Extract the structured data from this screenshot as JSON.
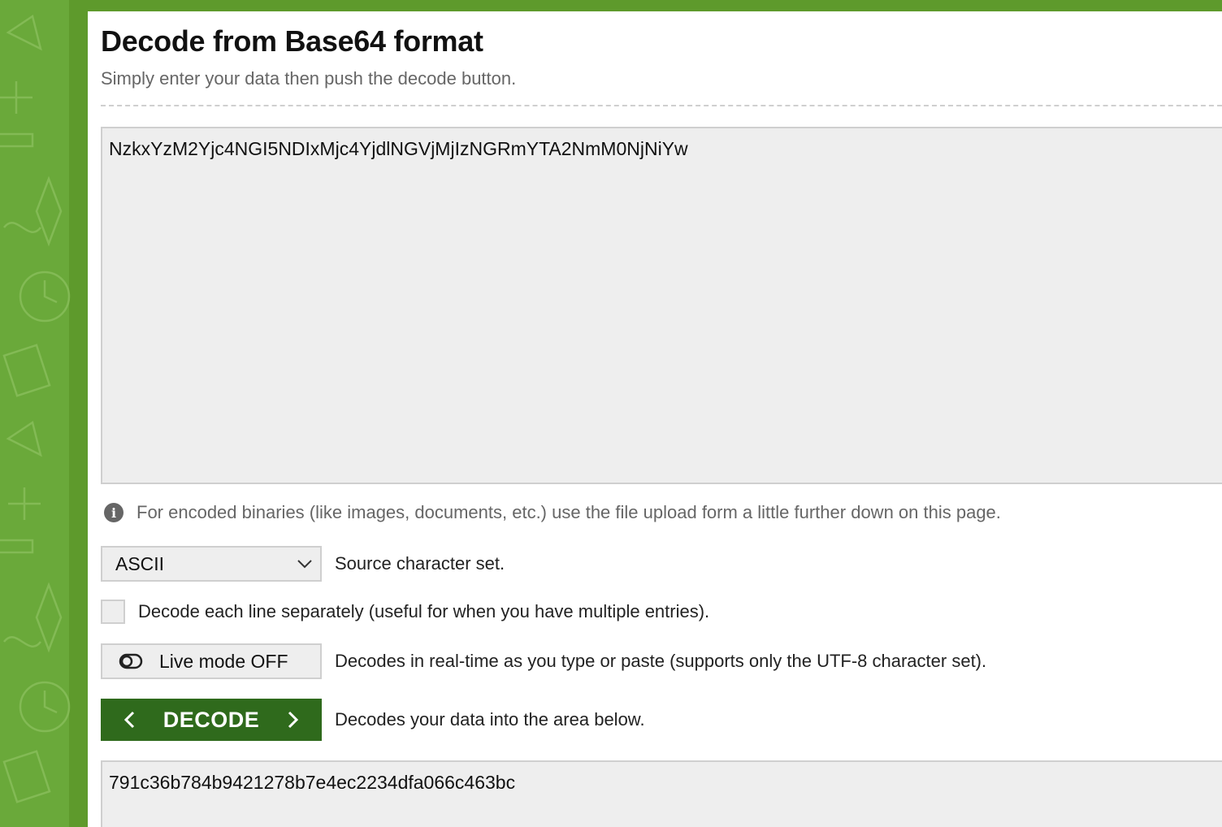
{
  "header": {
    "title": "Decode from Base64 format",
    "subtitle": "Simply enter your data then push the decode button."
  },
  "input": {
    "value": "NzkxYzM2Yjc4NGI5NDIxMjc4YjdlNGVjMjIzNGRmYTA2NmM0NjNiYw"
  },
  "hint": {
    "text": "For encoded binaries (like images, documents, etc.) use the file upload form a little further down on this page."
  },
  "options": {
    "charset": {
      "selected": "ASCII",
      "label": "Source character set."
    },
    "each_line": {
      "checked": false,
      "label": "Decode each line separately (useful for when you have multiple entries)."
    },
    "live_mode": {
      "button_label": "Live mode OFF",
      "label": "Decodes in real-time as you type or paste (supports only the UTF-8 character set)."
    },
    "decode": {
      "button_label": "DECODE",
      "label": "Decodes your data into the area below."
    }
  },
  "output": {
    "value": "791c36b784b9421278b7e4ec2234dfa066c463bc"
  },
  "colors": {
    "sidebar_green": "#6aa93a",
    "decode_button": "#2f6a1c",
    "field_background": "#eeeeee"
  }
}
